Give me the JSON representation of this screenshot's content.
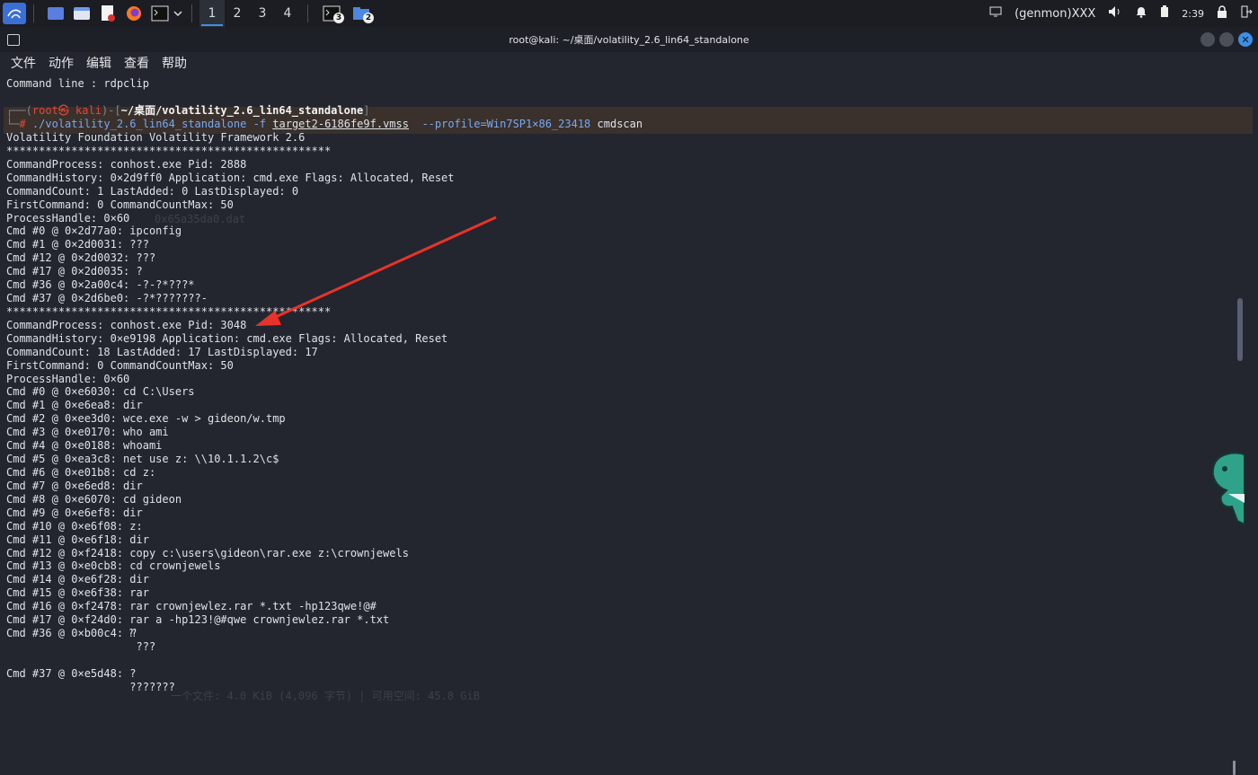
{
  "taskbar": {
    "workspaces": [
      "1",
      "2",
      "3",
      "4"
    ],
    "active_workspace_index": 0,
    "terminal_badge": "3",
    "files_badge": "2",
    "genmon": "(genmon)XXX",
    "clock": "2:39"
  },
  "window": {
    "title": "root@kali: ~/桌面/volatility_2.6_lin64_standalone"
  },
  "menu": [
    "文件",
    "动作",
    "编辑",
    "查看",
    "帮助"
  ],
  "terminal": {
    "pre_line": "Command line : rdpclip",
    "prompt": {
      "user_host": "root㉿ kali",
      "path": "~/桌面/volatility_2.6_lin64_standalone",
      "cmd_exec": "./volatility_2.6_lin64_standalone",
      "flag_f": "-f",
      "file": "target2-6186fe9f.vmss",
      "profile": "--profile=Win7SP1×86_23418",
      "plugin": "cmdscan"
    },
    "lines": [
      "Volatility Foundation Volatility Framework 2.6",
      "**************************************************",
      "CommandProcess: conhost.exe Pid: 2888",
      "CommandHistory: 0×2d9ff0 Application: cmd.exe Flags: Allocated, Reset",
      "CommandCount: 1 LastAdded: 0 LastDisplayed: 0",
      "FirstCommand: 0 CommandCountMax: 50",
      "ProcessHandle: 0×60",
      "Cmd #0 @ 0×2d77a0: ipconfig",
      "Cmd #1 @ 0×2d0031: ???",
      "Cmd #12 @ 0×2d0032: ???",
      "Cmd #17 @ 0×2d0035: ?",
      "Cmd #36 @ 0×2a00c4: -?-?*???*",
      "Cmd #37 @ 0×2d6be0: -?*???????-",
      "**************************************************",
      "CommandProcess: conhost.exe Pid: 3048",
      "CommandHistory: 0×e9198 Application: cmd.exe Flags: Allocated, Reset",
      "CommandCount: 18 LastAdded: 17 LastDisplayed: 17",
      "FirstCommand: 0 CommandCountMax: 50",
      "ProcessHandle: 0×60",
      "Cmd #0 @ 0×e6030: cd C:\\Users",
      "Cmd #1 @ 0×e6ea8: dir",
      "Cmd #2 @ 0×ee3d0: wce.exe -w > gideon/w.tmp",
      "Cmd #3 @ 0×e0170: who ami",
      "Cmd #4 @ 0×e0188: whoami",
      "Cmd #5 @ 0×ea3c8: net use z: \\\\10.1.1.2\\c$",
      "Cmd #6 @ 0×e01b8: cd z:",
      "Cmd #7 @ 0×e6ed8: dir",
      "Cmd #8 @ 0×e6070: cd gideon",
      "Cmd #9 @ 0×e6ef8: dir",
      "Cmd #10 @ 0×e6f08: z:",
      "Cmd #11 @ 0×e6f18: dir",
      "Cmd #12 @ 0×f2418: copy c:\\users\\gideon\\rar.exe z:\\crownjewels",
      "Cmd #13 @ 0×e0cb8: cd crownjewels",
      "Cmd #14 @ 0×e6f28: dir",
      "Cmd #15 @ 0×e6f38: rar",
      "Cmd #16 @ 0×f2478: rar crownjewlez.rar *.txt -hp123qwe!@#",
      "Cmd #17 @ 0×f24d0: rar a -hp123!@#qwe crownjewlez.rar *.txt",
      "Cmd #36 @ 0×b00c4: ⁇",
      "                    ???",
      "",
      "Cmd #37 @ 0×e5d48: ?",
      "                   ???????"
    ]
  },
  "colors": {
    "arrow": "#e8332a",
    "prompt_band": "#3a312c",
    "accent": "#3c8ee8"
  }
}
